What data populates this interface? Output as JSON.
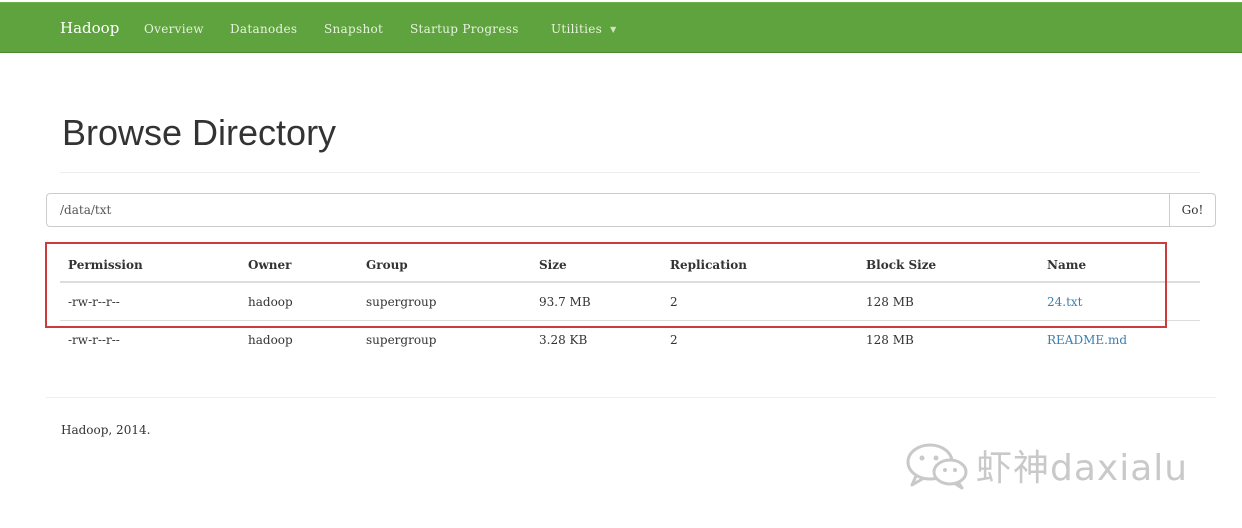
{
  "navbar": {
    "brand": "Hadoop",
    "items": [
      {
        "label": "Overview"
      },
      {
        "label": "Datanodes"
      },
      {
        "label": "Snapshot"
      },
      {
        "label": "Startup Progress"
      },
      {
        "label": "Utilities"
      }
    ]
  },
  "page": {
    "title": "Browse Directory",
    "path_value": "/data/txt",
    "go_label": "Go!"
  },
  "table": {
    "headers": [
      "Permission",
      "Owner",
      "Group",
      "Size",
      "Replication",
      "Block Size",
      "Name"
    ],
    "rows": [
      [
        "-rw-r--r--",
        "hadoop",
        "supergroup",
        "93.7 MB",
        "2",
        "128 MB",
        "24.txt"
      ],
      [
        "-rw-r--r--",
        "hadoop",
        "supergroup",
        "3.28 KB",
        "2",
        "128 MB",
        "README.md"
      ]
    ]
  },
  "footer": {
    "text": "Hadoop, 2014."
  },
  "watermark": {
    "text": "虾神daxialu",
    "icon": "wechat-icon"
  },
  "colors": {
    "navbar": "#5fa33e",
    "highlight": "#cd3c3c",
    "link": "#3b7fb0"
  }
}
